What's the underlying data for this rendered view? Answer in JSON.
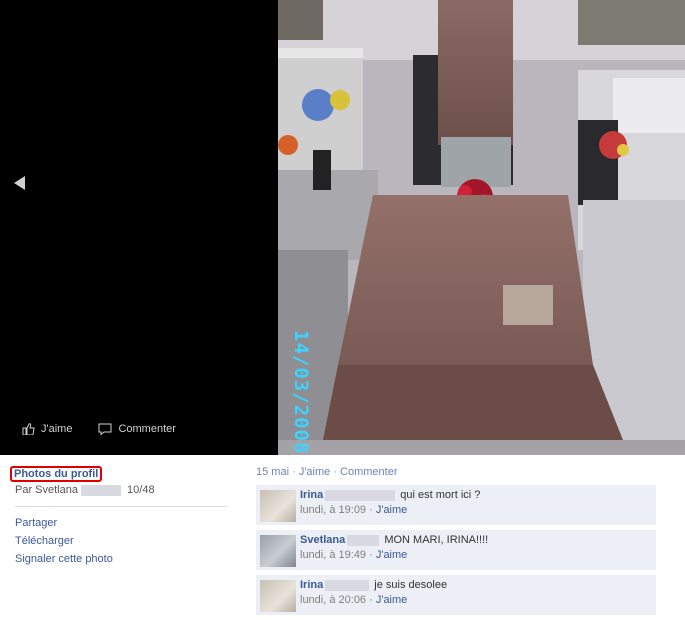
{
  "viewer": {
    "photo_timestamp": "14/03/2008",
    "like_label": "J'aime",
    "comment_label": "Commenter"
  },
  "info": {
    "album_link": "Photos du profil",
    "byline_prefix": "Par Svetlana",
    "position": "10/48",
    "actions": [
      "Partager",
      "Télécharger",
      "Signaler cette photo"
    ]
  },
  "feedback": {
    "date": "15 mai",
    "sep": " · ",
    "like": "J'aime",
    "comment": "Commenter",
    "comments": [
      {
        "author": "Irina",
        "text": "qui est mort ici ?",
        "time": "lundi, à 19:09",
        "like": "J'aime"
      },
      {
        "author": "Svetlana",
        "text": "MON MARI, IRINA!!!!",
        "time": "lundi, à 19:49",
        "like": "J'aime"
      },
      {
        "author": "Irina",
        "text": "je suis desolee",
        "time": "lundi, à 20:06",
        "like": "J'aime"
      }
    ]
  },
  "colors": {
    "link": "#3b5998",
    "highlight_box": "#e00000",
    "comment_bg": "#eceff5"
  }
}
